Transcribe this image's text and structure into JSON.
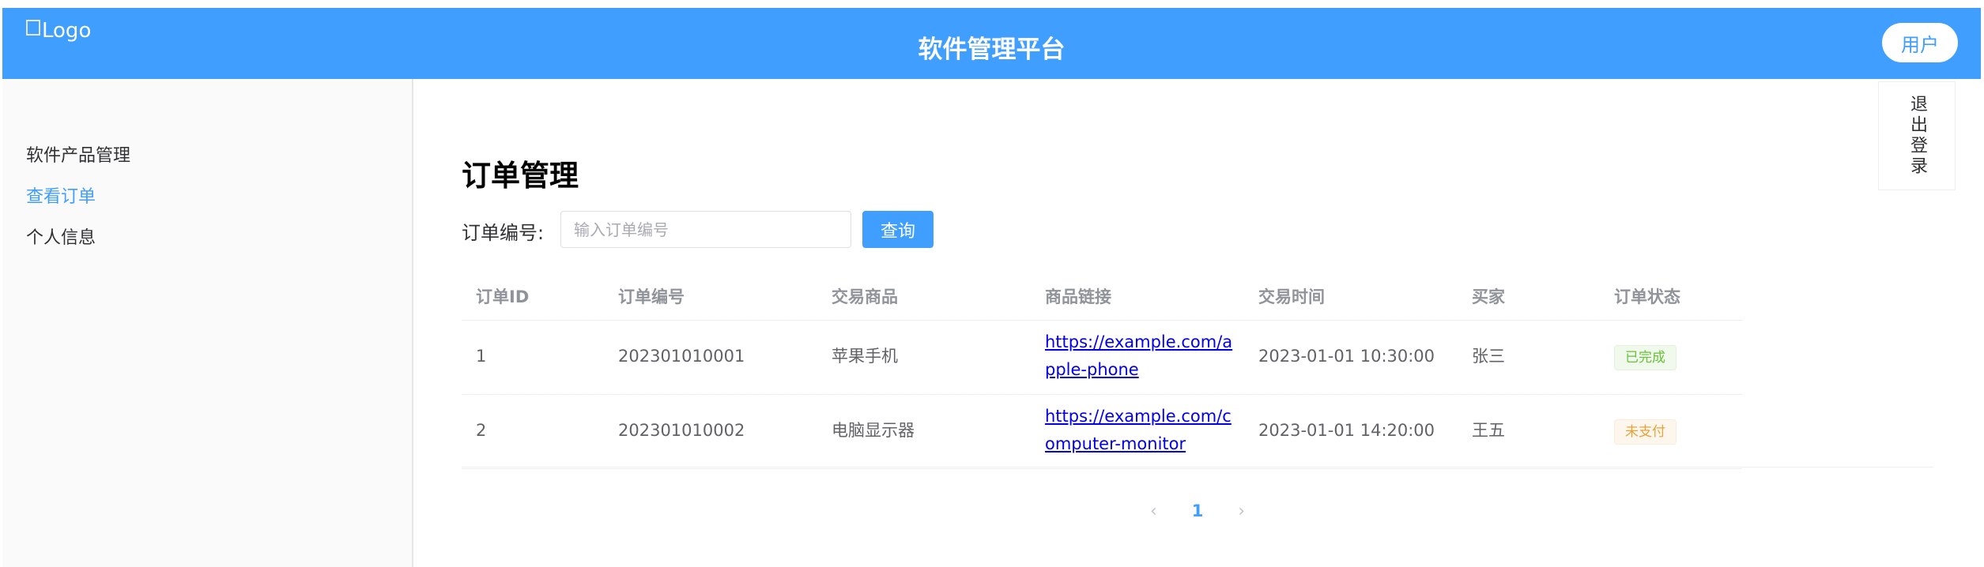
{
  "header": {
    "logo_alt": "Logo",
    "title": "软件管理平台",
    "user_button": "用户",
    "logout_label": "退出登录",
    "color": "#409eff"
  },
  "sidebar": {
    "items": [
      {
        "label": "软件产品管理",
        "active": false
      },
      {
        "label": "查看订单",
        "active": true
      },
      {
        "label": "个人信息",
        "active": false
      }
    ]
  },
  "main": {
    "title": "订单管理",
    "search": {
      "label": "订单编号:",
      "placeholder": "输入订单编号",
      "value": "",
      "button": "查询"
    },
    "table": {
      "columns": [
        "订单ID",
        "订单编号",
        "交易商品",
        "商品链接",
        "交易时间",
        "买家",
        "订单状态"
      ],
      "rows": [
        {
          "id": "1",
          "order_no": "202301010001",
          "product": "苹果手机",
          "link": "https://example.com/apple-phone",
          "time": "2023-01-01 10:30:00",
          "buyer": "张三",
          "status": "已完成",
          "status_type": "success"
        },
        {
          "id": "2",
          "order_no": "202301010002",
          "product": "电脑显示器",
          "link": "https://example.com/computer-monitor",
          "time": "2023-01-01 14:20:00",
          "buyer": "王五",
          "status": "未支付",
          "status_type": "warning"
        }
      ]
    },
    "pagination": {
      "prev_icon": "chevron-left-icon",
      "current_page": "1",
      "next_icon": "chevron-right-icon"
    }
  }
}
